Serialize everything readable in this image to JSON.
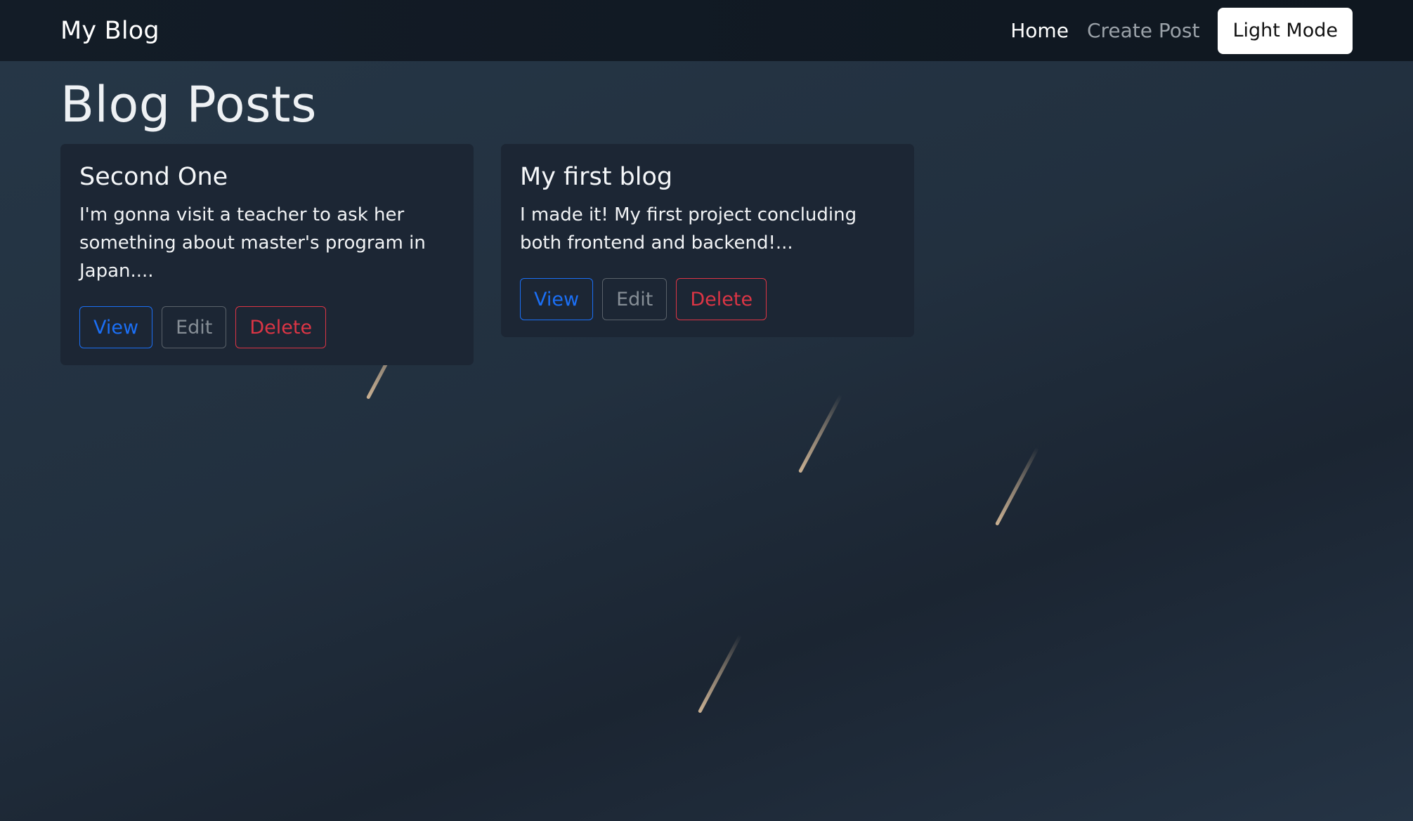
{
  "navbar": {
    "brand": "My Blog",
    "links": [
      {
        "label": "Home",
        "active": true
      },
      {
        "label": "Create Post",
        "active": false
      }
    ],
    "mode_button": "Light Mode"
  },
  "page": {
    "title": "Blog Posts"
  },
  "posts": [
    {
      "title": "Second One",
      "excerpt": "I'm gonna visit a teacher to ask her something about master's program in Japan....",
      "actions": {
        "view": "View",
        "edit": "Edit",
        "delete": "Delete"
      }
    },
    {
      "title": "My first blog",
      "excerpt": "I made it! My first project concluding both frontend and backend!...",
      "actions": {
        "view": "View",
        "edit": "Edit",
        "delete": "Delete"
      }
    }
  ],
  "colors": {
    "primary": "#1b6ff5",
    "secondary": "#868e96",
    "danger": "#dc3545",
    "navbar_bg": "#111a24",
    "card_bg": "#1c2634"
  }
}
